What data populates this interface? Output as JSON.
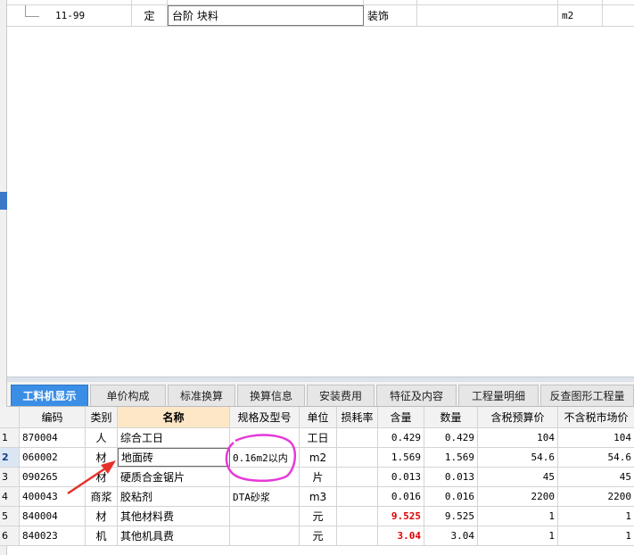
{
  "top_grid": {
    "row": {
      "code": "11-99",
      "type": "定",
      "name": "台阶 块料",
      "category": "装饰",
      "unit": "m2"
    }
  },
  "tabs": [
    {
      "label": "工料机显示",
      "active": true
    },
    {
      "label": "单价构成"
    },
    {
      "label": "标准换算"
    },
    {
      "label": "换算信息"
    },
    {
      "label": "安装费用"
    },
    {
      "label": "特征及内容"
    },
    {
      "label": "工程量明细"
    },
    {
      "label": "反查图形工程量"
    }
  ],
  "table": {
    "headers": [
      "编码",
      "类别",
      "名称",
      "规格及型号",
      "单位",
      "损耗率",
      "含量",
      "数量",
      "含税预算价",
      "不含税市场价"
    ],
    "rows": [
      {
        "num": "1",
        "code": "870004",
        "type": "人",
        "name": "综合工日",
        "spec": "",
        "unit": "工日",
        "loss": "",
        "content": "0.429",
        "qty": "0.429",
        "tax_price": "104",
        "market": "104"
      },
      {
        "num": "2",
        "code": "060002",
        "type": "材",
        "name": "地面砖",
        "spec": "0.16m2以内",
        "unit": "m2",
        "loss": "",
        "content": "1.569",
        "qty": "1.569",
        "tax_price": "54.6",
        "market": "54.6"
      },
      {
        "num": "3",
        "code": "090265",
        "type": "材",
        "name": "硬质合金锯片",
        "spec": "",
        "unit": "片",
        "loss": "",
        "content": "0.013",
        "qty": "0.013",
        "tax_price": "45",
        "market": "45"
      },
      {
        "num": "4",
        "code": "400043",
        "type": "商浆",
        "name": "胶粘剂",
        "spec": "DTA砂浆",
        "unit": "m3",
        "loss": "",
        "content": "0.016",
        "qty": "0.016",
        "tax_price": "2200",
        "market": "2200"
      },
      {
        "num": "5",
        "code": "840004",
        "type": "材",
        "name": "其他材料费",
        "spec": "",
        "unit": "元",
        "loss": "",
        "content": "9.525",
        "qty": "9.525",
        "tax_price": "1",
        "market": "1"
      },
      {
        "num": "6",
        "code": "840023",
        "type": "机",
        "name": "其他机具费",
        "spec": "",
        "unit": "元",
        "loss": "",
        "content": "3.04",
        "qty": "3.04",
        "tax_price": "1",
        "market": "1"
      }
    ]
  },
  "colors": {
    "tab_active": "#3a8ee6",
    "name_header_bg": "#fde7c7",
    "annotation_circle": "#e63ad7",
    "annotation_arrow": "#e8302a",
    "highlight_red": "#e00000"
  }
}
